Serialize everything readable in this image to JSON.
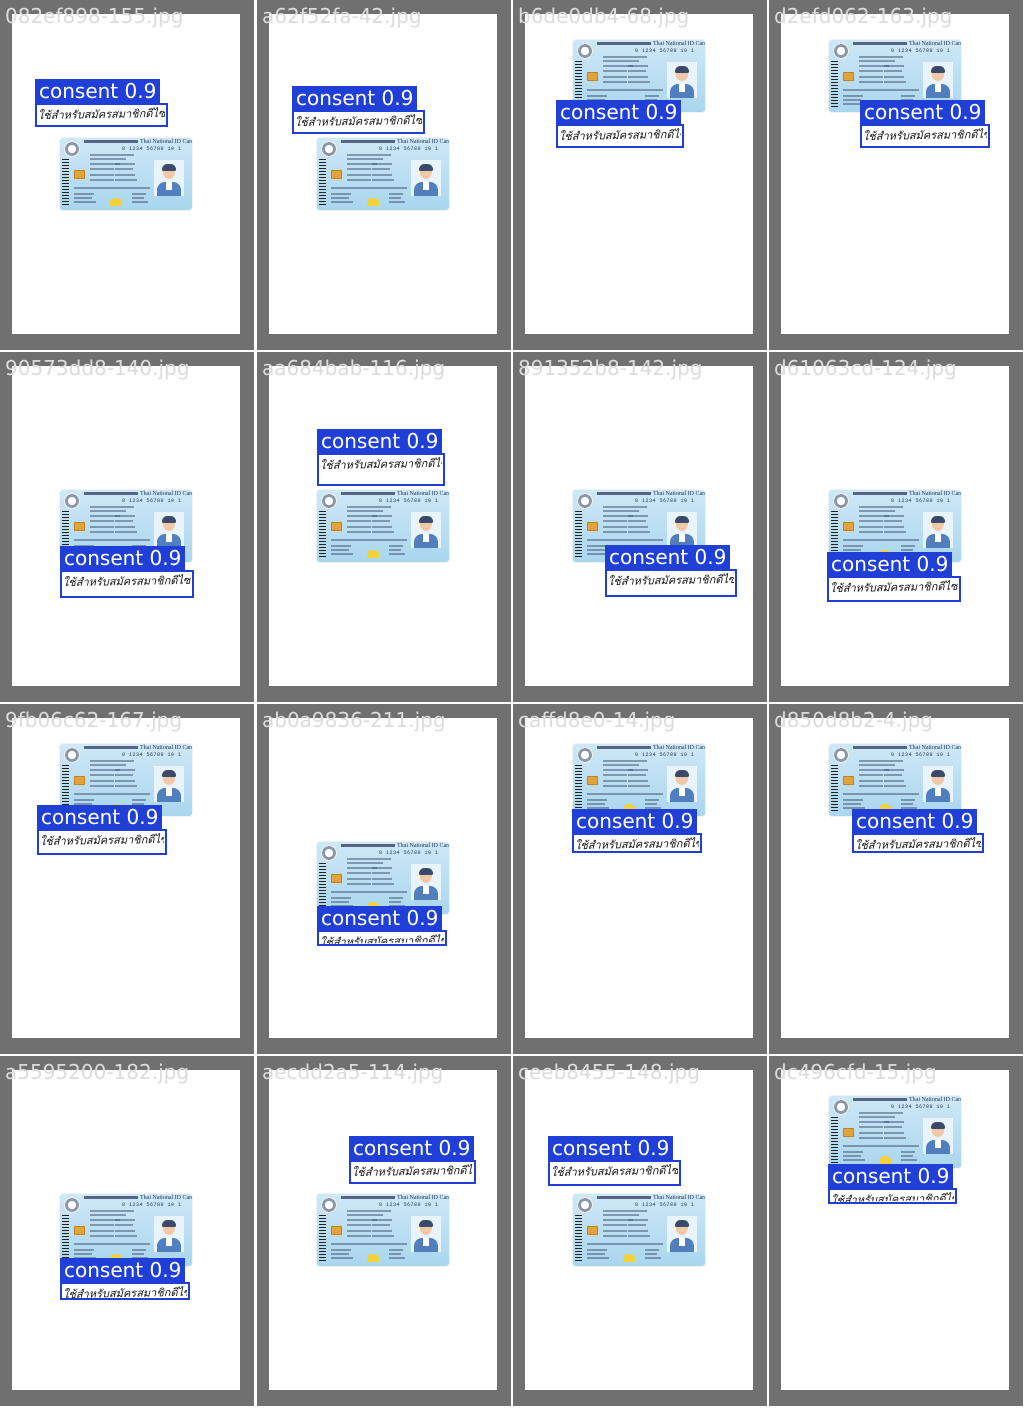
{
  "card_text": {
    "title_en": "Thai National ID Card",
    "id_number": "0 1234 56789 10 1"
  },
  "handwriting_text": "ใช้สำหรับสมัครสมาชิกดีไซน์ประดับ",
  "colors": {
    "tile_bg": "#707070",
    "page_bg": "#ffffff",
    "box": "#1f3fd6",
    "filename_text": "#dcdcdc"
  },
  "tiles": [
    {
      "filename": "082ef898-155.jpg",
      "label": "consent 0.9"
    },
    {
      "filename": "a62f52fa-42.jpg",
      "label": "consent 0.9"
    },
    {
      "filename": "b6de0db4-68.jpg",
      "label": "consent 0.9"
    },
    {
      "filename": "d2efd062-163.jpg",
      "label": "consent 0.9"
    },
    {
      "filename": "90573dd8-140.jpg",
      "label": "consent 0.9"
    },
    {
      "filename": "aa684bab-116.jpg",
      "label": "consent 0.9"
    },
    {
      "filename": "891352b8-142.jpg",
      "label": "consent 0.9"
    },
    {
      "filename": "d61063cd-124.jpg",
      "label": "consent 0.9"
    },
    {
      "filename": "9fb06c62-167.jpg",
      "label": "consent 0.9"
    },
    {
      "filename": "ab0a9836-211.jpg",
      "label": "consent 0.9"
    },
    {
      "filename": "caffd8e0-14.jpg",
      "label": "consent 0.9"
    },
    {
      "filename": "d850d8b2-4.jpg",
      "label": "consent 0.9"
    },
    {
      "filename": "a5595200-182.jpg",
      "label": "consent 0.9"
    },
    {
      "filename": "aecdd2a5-114.jpg",
      "label": "consent 0.9"
    },
    {
      "filename": "ceeb8455-148.jpg",
      "label": "consent 0.9"
    },
    {
      "filename": "dc496cfd-15.jpg",
      "label": "consent 0.9"
    }
  ]
}
